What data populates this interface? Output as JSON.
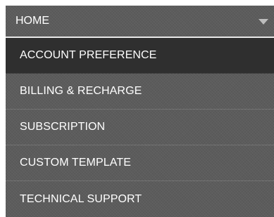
{
  "menu": {
    "header_label": "HOME",
    "items": [
      {
        "label": "ACCOUNT PREFERENCE",
        "active": true
      },
      {
        "label": "BILLING & RECHARGE",
        "active": false
      },
      {
        "label": "SUBSCRIPTION",
        "active": false
      },
      {
        "label": "CUSTOM TEMPLATE",
        "active": false
      },
      {
        "label": "TECHNICAL SUPPORT",
        "active": false
      }
    ]
  },
  "colors": {
    "menu_background": "#5c5c5c",
    "active_item_background": "#2f2f2f",
    "text": "#ffffff",
    "caret": "#bdbdbd",
    "header_divider": "#e9e9e9"
  },
  "icons": {
    "header_caret": "caret-down-icon"
  }
}
